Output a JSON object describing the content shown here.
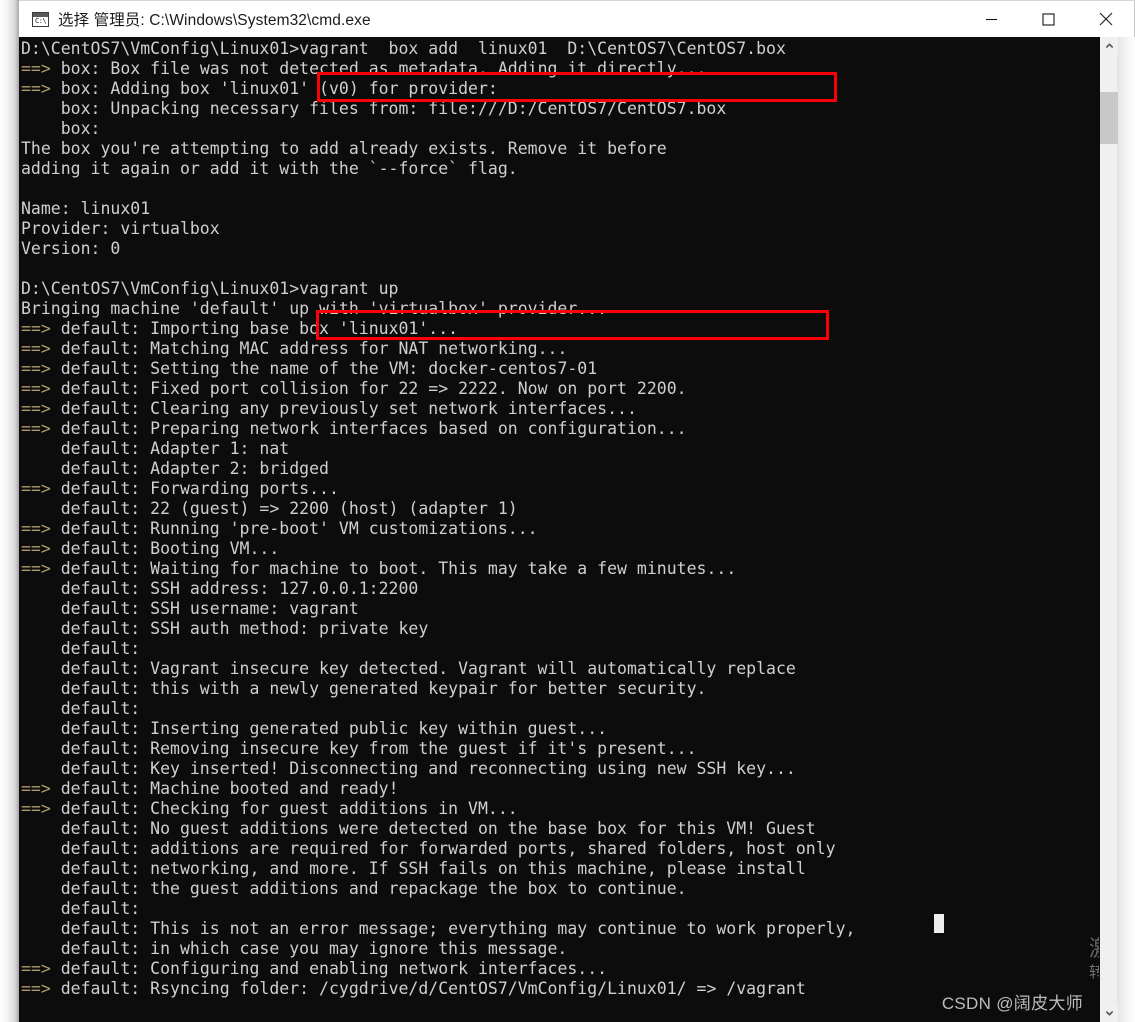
{
  "window": {
    "title": "选择 管理员: C:\\Windows\\System32\\cmd.exe",
    "icon": "cmd-icon",
    "icon_glyph": "C:\\",
    "controls": {
      "minimize": "minimize",
      "maximize": "maximize",
      "close": "close"
    }
  },
  "terminal": {
    "background_color": "#0c0c0c",
    "text_color": "#cccccc",
    "arrow_color": "#b09a6b",
    "lines": [
      {
        "arrow": "",
        "text": "D:\\CentOS7\\VmConfig\\Linux01>vagrant  box add  linux01  D:\\CentOS7\\CentOS7.box"
      },
      {
        "arrow": "==>",
        "text": " box: Box file was not detected as metadata. Adding it directly..."
      },
      {
        "arrow": "==>",
        "text": " box: Adding box 'linux01' (v0) for provider:"
      },
      {
        "arrow": "",
        "text": "    box: Unpacking necessary files from: file:///D:/CentOS7/CentOS7.box"
      },
      {
        "arrow": "",
        "text": "    box:"
      },
      {
        "arrow": "",
        "text": "The box you're attempting to add already exists. Remove it before"
      },
      {
        "arrow": "",
        "text": "adding it again or add it with the `--force` flag."
      },
      {
        "arrow": "",
        "text": ""
      },
      {
        "arrow": "",
        "text": "Name: linux01"
      },
      {
        "arrow": "",
        "text": "Provider: virtualbox"
      },
      {
        "arrow": "",
        "text": "Version: 0"
      },
      {
        "arrow": "",
        "text": ""
      },
      {
        "arrow": "",
        "text": "D:\\CentOS7\\VmConfig\\Linux01>vagrant up"
      },
      {
        "arrow": "",
        "text": "Bringing machine 'default' up with 'virtualbox' provider..."
      },
      {
        "arrow": "==>",
        "text": " default: Importing base box 'linux01'..."
      },
      {
        "arrow": "==>",
        "text": " default: Matching MAC address for NAT networking..."
      },
      {
        "arrow": "==>",
        "text": " default: Setting the name of the VM: docker-centos7-01"
      },
      {
        "arrow": "==>",
        "text": " default: Fixed port collision for 22 => 2222. Now on port 2200."
      },
      {
        "arrow": "==>",
        "text": " default: Clearing any previously set network interfaces..."
      },
      {
        "arrow": "==>",
        "text": " default: Preparing network interfaces based on configuration..."
      },
      {
        "arrow": "",
        "text": "    default: Adapter 1: nat"
      },
      {
        "arrow": "",
        "text": "    default: Adapter 2: bridged"
      },
      {
        "arrow": "==>",
        "text": " default: Forwarding ports..."
      },
      {
        "arrow": "",
        "text": "    default: 22 (guest) => 2200 (host) (adapter 1)"
      },
      {
        "arrow": "==>",
        "text": " default: Running 'pre-boot' VM customizations..."
      },
      {
        "arrow": "==>",
        "text": " default: Booting VM..."
      },
      {
        "arrow": "==>",
        "text": " default: Waiting for machine to boot. This may take a few minutes..."
      },
      {
        "arrow": "",
        "text": "    default: SSH address: 127.0.0.1:2200"
      },
      {
        "arrow": "",
        "text": "    default: SSH username: vagrant"
      },
      {
        "arrow": "",
        "text": "    default: SSH auth method: private key"
      },
      {
        "arrow": "",
        "text": "    default:"
      },
      {
        "arrow": "",
        "text": "    default: Vagrant insecure key detected. Vagrant will automatically replace"
      },
      {
        "arrow": "",
        "text": "    default: this with a newly generated keypair for better security."
      },
      {
        "arrow": "",
        "text": "    default:"
      },
      {
        "arrow": "",
        "text": "    default: Inserting generated public key within guest..."
      },
      {
        "arrow": "",
        "text": "    default: Removing insecure key from the guest if it's present..."
      },
      {
        "arrow": "",
        "text": "    default: Key inserted! Disconnecting and reconnecting using new SSH key..."
      },
      {
        "arrow": "==>",
        "text": " default: Machine booted and ready!"
      },
      {
        "arrow": "==>",
        "text": " default: Checking for guest additions in VM..."
      },
      {
        "arrow": "",
        "text": "    default: No guest additions were detected on the base box for this VM! Guest"
      },
      {
        "arrow": "",
        "text": "    default: additions are required for forwarded ports, shared folders, host only"
      },
      {
        "arrow": "",
        "text": "    default: networking, and more. If SSH fails on this machine, please install"
      },
      {
        "arrow": "",
        "text": "    default: the guest additions and repackage the box to continue."
      },
      {
        "arrow": "",
        "text": "    default:"
      },
      {
        "arrow": "",
        "text": "    default: This is not an error message; everything may continue to work properly,"
      },
      {
        "arrow": "",
        "text": "    default: in which case you may ignore this message."
      },
      {
        "arrow": "==>",
        "text": " default: Configuring and enabling network interfaces..."
      },
      {
        "arrow": "==>",
        "text": " default: Rsyncing folder: /cygdrive/d/CentOS7/VmConfig/Linux01/ => /vagrant"
      }
    ]
  },
  "annotations": {
    "highlight_color": "#fb0007",
    "boxes": [
      {
        "label": "vagrant  box add  linux01  D:\\CentOS7\\CentOS7.box"
      },
      {
        "label": "vagrant up"
      }
    ]
  },
  "scrollbar": {
    "up_arrow": "chevron-up",
    "down_arrow": "chevron-down"
  },
  "watermarks": {
    "csdn": "CSDN @阔皮大师",
    "activation_line1": "激活",
    "activation_line2": "转到"
  }
}
